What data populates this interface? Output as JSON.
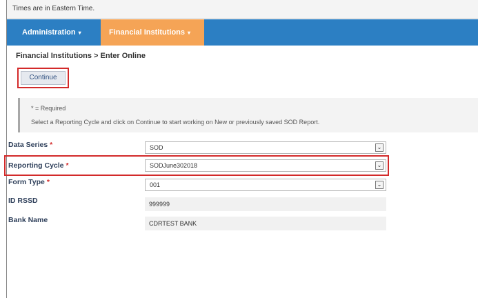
{
  "top_note": "Times are in Eastern Time.",
  "nav": {
    "admin_label": "Administration",
    "financial_label": "Financial Institutions"
  },
  "breadcrumb": "Financial Institutions > Enter Online",
  "continue_label": "Continue",
  "info": {
    "required_note": "* = Required",
    "instructions": "Select a Reporting Cycle and click on Continue to start working on New or previously saved SOD Report."
  },
  "form": {
    "data_series_label": "Data Series",
    "data_series_value": "SOD",
    "reporting_cycle_label": "Reporting Cycle",
    "reporting_cycle_value": "SODJune302018",
    "form_type_label": "Form Type",
    "form_type_value": "001",
    "id_rssd_label": "ID RSSD",
    "id_rssd_value": "999999",
    "bank_name_label": "Bank Name",
    "bank_name_value": "CDRTEST BANK"
  },
  "colors": {
    "nav_blue": "#2c7fc3",
    "nav_orange": "#f5a456",
    "highlight_red": "#d32a2a"
  }
}
